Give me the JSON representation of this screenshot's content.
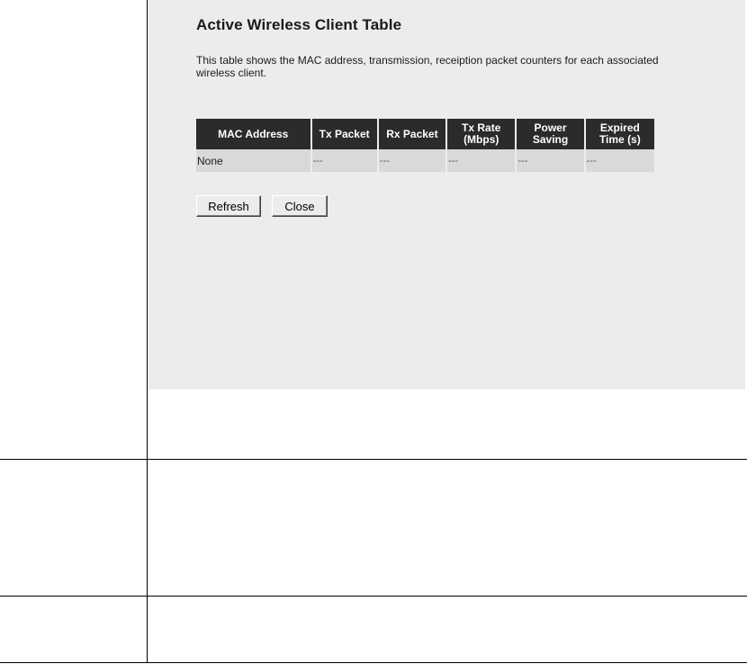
{
  "panel": {
    "title": "Active Wireless Client Table",
    "description": "This table shows the MAC address, transmission, receiption packet counters for each associated wireless client."
  },
  "table": {
    "headers": {
      "mac": "MAC Address",
      "tx": "Tx Packet",
      "rx": "Rx Packet",
      "rate_line1": "Tx Rate",
      "rate_line2": "(Mbps)",
      "power_line1": "Power",
      "power_line2": "Saving",
      "expired_line1": "Expired",
      "expired_line2": "Time (s)"
    },
    "row": {
      "mac": "None",
      "tx": "---",
      "rx": "---",
      "rate": "---",
      "power": "---",
      "expired": "---"
    }
  },
  "buttons": {
    "refresh": "Refresh",
    "close": "Close"
  }
}
